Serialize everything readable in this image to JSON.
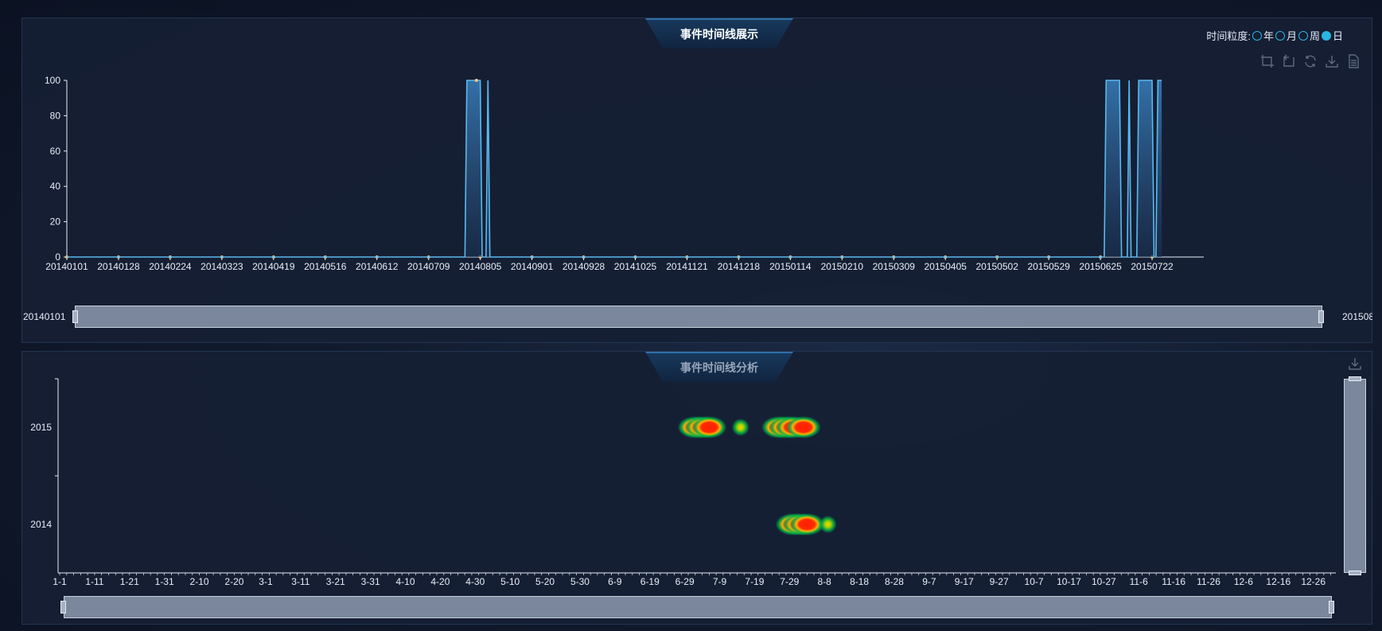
{
  "top_panel": {
    "title": "事件时间线展示",
    "granularity": {
      "label": "时间粒度:",
      "options": [
        {
          "label": "年",
          "checked": false
        },
        {
          "label": "月",
          "checked": false
        },
        {
          "label": "周",
          "checked": false
        },
        {
          "label": "日",
          "checked": true
        }
      ]
    },
    "toolbox": [
      "zoom-area-icon",
      "zoom-reset-icon",
      "refresh-icon",
      "save-image-icon",
      "data-view-icon"
    ],
    "slider": {
      "start_label": "20140101",
      "end_label": "201508"
    }
  },
  "bottom_panel": {
    "title": "事件时间线分析",
    "toolbox": [
      "save-image-icon"
    ]
  },
  "colors": {
    "line": "#5ab9ee",
    "area_top": "#2f6fa8",
    "axis": "#e8eef8",
    "slider_fill": "#7a879c",
    "radio": "#29b5e0",
    "heat_core": "#ff1e00",
    "heat_mid": "#ffb400",
    "heat_edge": "#00b44a"
  },
  "chart_data": [
    {
      "type": "area",
      "x_ticks": [
        "20140101",
        "20140128",
        "20140224",
        "20140323",
        "20140419",
        "20140516",
        "20140612",
        "20140709",
        "20140805",
        "20140901",
        "20140928",
        "20141025",
        "20141121",
        "20141218",
        "20150114",
        "20150210",
        "20150309",
        "20150405",
        "20150502",
        "20150529",
        "20150625",
        "20150722"
      ],
      "y_ticks": [
        "0",
        "20",
        "40",
        "60",
        "80",
        "100"
      ],
      "ylim": [
        0,
        100
      ],
      "x_range": [
        "20140101",
        "20150818"
      ],
      "x": [
        "20140101",
        "20140728",
        "20140729",
        "20140805",
        "20140806",
        "20140808",
        "20140809",
        "20140810",
        "20150627",
        "20150628",
        "20150705",
        "20150706",
        "20150709",
        "20150710",
        "20150711",
        "20150714",
        "20150715",
        "20150722",
        "20150723",
        "20150724",
        "20150725",
        "20150727"
      ],
      "y": [
        0,
        0,
        100,
        100,
        0,
        0,
        100,
        0,
        0,
        100,
        100,
        0,
        0,
        100,
        0,
        0,
        100,
        100,
        0,
        0,
        100,
        100
      ],
      "grid": false
    },
    {
      "type": "heatmap",
      "x_ticks": [
        "1-1",
        "1-11",
        "1-21",
        "1-31",
        "2-10",
        "2-20",
        "3-1",
        "3-11",
        "3-21",
        "3-31",
        "4-10",
        "4-20",
        "4-30",
        "5-10",
        "5-20",
        "5-30",
        "6-9",
        "6-19",
        "6-29",
        "7-9",
        "7-19",
        "7-29",
        "8-8",
        "8-18",
        "8-28",
        "9-7",
        "9-17",
        "9-27",
        "10-7",
        "10-17",
        "10-27",
        "11-6",
        "11-16",
        "11-26",
        "12-6",
        "12-16",
        "12-26"
      ],
      "y_ticks": [
        "2014",
        "2015"
      ],
      "points": [
        {
          "year": "2015",
          "date": "7-2",
          "value": 1.0
        },
        {
          "year": "2015",
          "date": "7-4",
          "value": 1.0
        },
        {
          "year": "2015",
          "date": "7-6",
          "value": 1.0
        },
        {
          "year": "2015",
          "date": "7-15",
          "value": 0.35
        },
        {
          "year": "2015",
          "date": "7-26",
          "value": 1.0
        },
        {
          "year": "2015",
          "date": "7-28",
          "value": 1.0
        },
        {
          "year": "2015",
          "date": "7-30",
          "value": 1.0
        },
        {
          "year": "2015",
          "date": "8-2",
          "value": 1.0
        },
        {
          "year": "2014",
          "date": "7-30",
          "value": 1.0
        },
        {
          "year": "2014",
          "date": "8-1",
          "value": 1.0
        },
        {
          "year": "2014",
          "date": "8-3",
          "value": 1.0
        },
        {
          "year": "2014",
          "date": "8-9",
          "value": 0.4
        }
      ]
    }
  ]
}
